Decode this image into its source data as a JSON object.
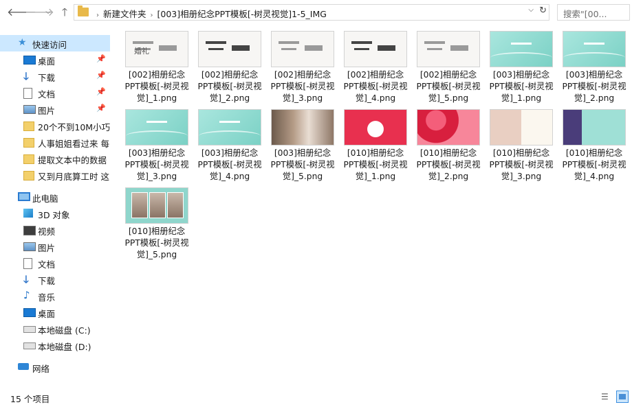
{
  "toolbar": {
    "back_icon": "arrow-left-icon",
    "forward_icon": "arrow-right-icon",
    "recent_icon": "chevron-down-icon",
    "up_icon": "arrow-up-icon"
  },
  "address": {
    "crumbs": [
      "新建文件夹",
      "[003]相册纪念PPT模板[-树灵视觉]1-5_IMG"
    ],
    "separator": "›",
    "dropdown": "⌵",
    "refresh": "↻"
  },
  "search": {
    "placeholder": "搜索\"[00..."
  },
  "sidebar": {
    "quick_access": "快速访问",
    "quick_items": [
      {
        "label": "桌面",
        "icon": "desktop-icon",
        "pinned": true
      },
      {
        "label": "下载",
        "icon": "download-icon",
        "pinned": true
      },
      {
        "label": "文档",
        "icon": "document-icon",
        "pinned": true
      },
      {
        "label": "图片",
        "icon": "pictures-icon",
        "pinned": true
      },
      {
        "label": "20个不到10M小巧",
        "icon": "folder-icon"
      },
      {
        "label": "人事姐姐看过来 每日",
        "icon": "folder-icon"
      },
      {
        "label": "提取文本中的数据 ",
        "icon": "folder-icon"
      },
      {
        "label": "又到月底算工时 这",
        "icon": "folder-icon"
      }
    ],
    "this_pc": "此电脑",
    "pc_items": [
      {
        "label": "3D 对象",
        "icon": "3d-objects-icon"
      },
      {
        "label": "视频",
        "icon": "video-icon"
      },
      {
        "label": "图片",
        "icon": "pictures-icon"
      },
      {
        "label": "文档",
        "icon": "document-icon"
      },
      {
        "label": "下载",
        "icon": "download-icon"
      },
      {
        "label": "音乐",
        "icon": "music-icon"
      },
      {
        "label": "桌面",
        "icon": "desktop-icon"
      },
      {
        "label": "本地磁盘 (C:)",
        "icon": "disk-c-icon"
      },
      {
        "label": "本地磁盘 (D:)",
        "icon": "disk-d-icon"
      }
    ],
    "network": "网络"
  },
  "files": [
    {
      "name": "[002]相册纪念PPT模板[-树灵视觉]_1.png",
      "thumb": "white",
      "text": "婚礼"
    },
    {
      "name": "[002]相册纪念PPT模板[-树灵视觉]_2.png",
      "thumb": "white"
    },
    {
      "name": "[002]相册纪念PPT模板[-树灵视觉]_3.png",
      "thumb": "white"
    },
    {
      "name": "[002]相册纪念PPT模板[-树灵视觉]_4.png",
      "thumb": "white"
    },
    {
      "name": "[002]相册纪念PPT模板[-树灵视觉]_5.png",
      "thumb": "white"
    },
    {
      "name": "[003]相册纪念PPT模板[-树灵视觉]_1.png",
      "thumb": "teal"
    },
    {
      "name": "[003]相册纪念PPT模板[-树灵视觉]_2.png",
      "thumb": "teal"
    },
    {
      "name": "[003]相册纪念PPT模板[-树灵视觉]_3.png",
      "thumb": "teal"
    },
    {
      "name": "[003]相册纪念PPT模板[-树灵视觉]_4.png",
      "thumb": "teal"
    },
    {
      "name": "[003]相册纪念PPT模板[-树灵视觉]_5.png",
      "thumb": "photo"
    },
    {
      "name": "[010]相册纪念PPT模板[-树灵视觉]_1.png",
      "thumb": "red"
    },
    {
      "name": "[010]相册纪念PPT模板[-树灵视觉]_2.png",
      "thumb": "red2"
    },
    {
      "name": "[010]相册纪念PPT模板[-树灵视觉]_3.png",
      "thumb": "flower"
    },
    {
      "name": "[010]相册纪念PPT模板[-树灵视觉]_4.png",
      "thumb": "purple"
    },
    {
      "name": "[010]相册纪念PPT模板[-树灵视觉]_5.png",
      "thumb": "collage"
    }
  ],
  "status": {
    "count": "15 个项目"
  }
}
